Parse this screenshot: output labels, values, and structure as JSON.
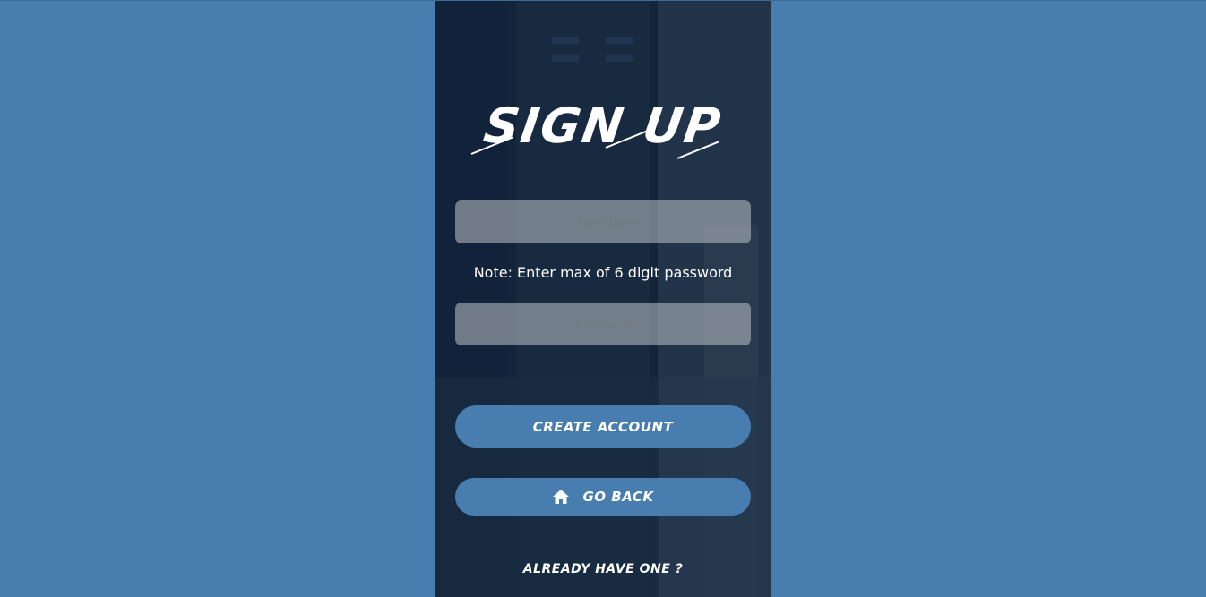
{
  "page": {
    "title": "SIGN UP",
    "note": "Note: Enter max of 6 digit password"
  },
  "form": {
    "username_placeholder": "User Name",
    "username_value": "",
    "password_placeholder": "Password",
    "password_value": ""
  },
  "buttons": {
    "create_account": "CREATE ACCOUNT",
    "go_back": "GO BACK",
    "go_back_icon": "home-icon"
  },
  "links": {
    "already_have_one": "ALREADY HAVE ONE ?"
  },
  "colors": {
    "page_background": "#487DB0",
    "panel_background": "#15263A",
    "button_background": "#487DB0",
    "text": "#FFFFFF"
  }
}
